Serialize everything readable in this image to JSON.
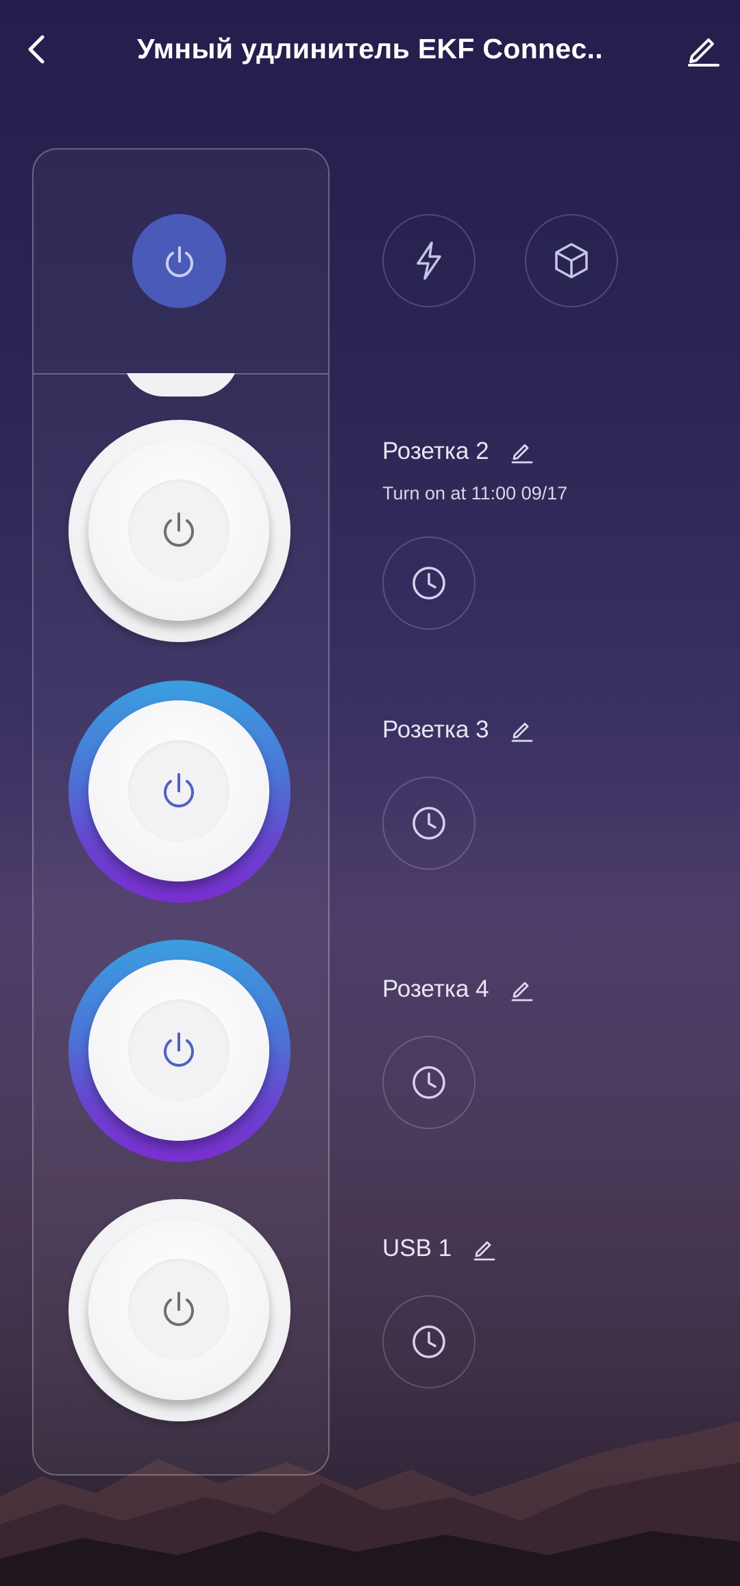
{
  "header": {
    "title": "Умный удлинитель EKF Connec..",
    "back_icon": "chevron-left-icon",
    "edit_icon": "pencil-icon"
  },
  "controls": {
    "master_icon": "power-icon",
    "master_state": "on",
    "energy_icon": "lightning-icon",
    "scene_icon": "cube-icon"
  },
  "outlets": [
    {
      "label": "Розетка 2",
      "state": "off",
      "schedule": "Turn on at 11:00 09/17"
    },
    {
      "label": "Розетка 3",
      "state": "on"
    },
    {
      "label": "Розетка 4",
      "state": "on"
    },
    {
      "label": "USB 1",
      "state": "off"
    }
  ],
  "colors": {
    "accent": "#4a5ab8",
    "on_gradient_top": "#3a9fe0",
    "on_gradient_bottom": "#7a2fcf",
    "off_icon": "#6f6f6f",
    "on_icon": "#5061bf"
  }
}
